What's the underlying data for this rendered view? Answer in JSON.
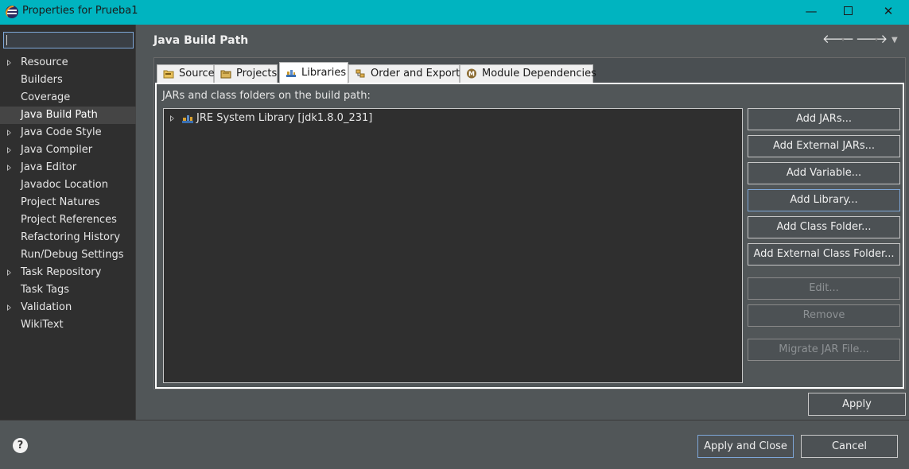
{
  "window": {
    "title": "Properties for Prueba1",
    "minimize_glyph": "—",
    "close_glyph": "✕"
  },
  "filter": {
    "value": ""
  },
  "sidebar": {
    "items": [
      {
        "label": "Resource",
        "expandable": true
      },
      {
        "label": "Builders",
        "expandable": false
      },
      {
        "label": "Coverage",
        "expandable": false
      },
      {
        "label": "Java Build Path",
        "expandable": false,
        "selected": true
      },
      {
        "label": "Java Code Style",
        "expandable": true
      },
      {
        "label": "Java Compiler",
        "expandable": true
      },
      {
        "label": "Java Editor",
        "expandable": true
      },
      {
        "label": "Javadoc Location",
        "expandable": false
      },
      {
        "label": "Project Natures",
        "expandable": false
      },
      {
        "label": "Project References",
        "expandable": false
      },
      {
        "label": "Refactoring History",
        "expandable": false
      },
      {
        "label": "Run/Debug Settings",
        "expandable": false
      },
      {
        "label": "Task Repository",
        "expandable": true
      },
      {
        "label": "Task Tags",
        "expandable": false
      },
      {
        "label": "Validation",
        "expandable": true
      },
      {
        "label": "WikiText",
        "expandable": false
      }
    ]
  },
  "header": {
    "title": "Java Build Path",
    "back_glyph": "🡐",
    "forward_glyph": "🡒",
    "dropdown_glyph": "▾",
    "menu_glyph": "▼"
  },
  "tabs": [
    {
      "label": "Source",
      "icon": "source-folder-icon"
    },
    {
      "label": "Projects",
      "icon": "projects-icon"
    },
    {
      "label": "Libraries",
      "icon": "libraries-icon",
      "active": true
    },
    {
      "label": "Order and Export",
      "icon": "order-export-icon"
    },
    {
      "label": "Module Dependencies",
      "icon": "module-icon"
    }
  ],
  "libraries": {
    "caption": "JARs and class folders on the build path:",
    "entries": [
      {
        "label": "JRE System Library [jdk1.8.0_231]",
        "icon": "jre-library-icon"
      }
    ]
  },
  "buttons": {
    "add_jars": "Add JARs...",
    "add_external_jars": "Add External JARs...",
    "add_variable": "Add Variable...",
    "add_library": "Add Library...",
    "add_class_folder": "Add Class Folder...",
    "add_external_class_folder": "Add External Class Folder...",
    "edit": "Edit...",
    "remove": "Remove",
    "migrate_jar": "Migrate JAR File...",
    "apply": "Apply",
    "apply_and_close": "Apply and Close",
    "cancel": "Cancel",
    "help": "?"
  },
  "colors": {
    "titlebar": "#00b4c0",
    "background": "#515658",
    "tree_background": "#2f2f2f",
    "focus_border": "#7ea7d8"
  }
}
